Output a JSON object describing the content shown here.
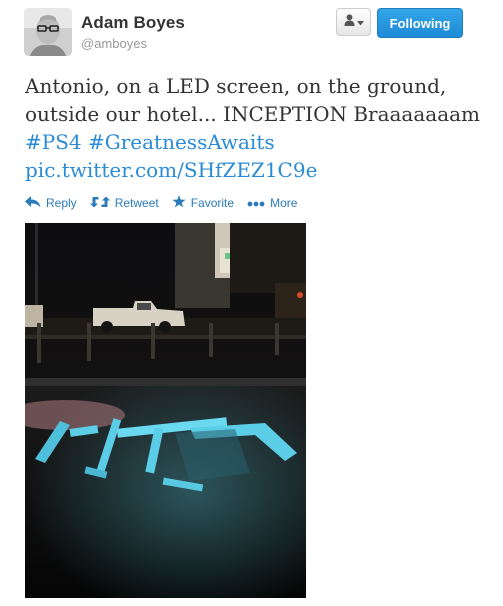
{
  "user": {
    "name": "Adam Boyes",
    "handle": "@amboyes"
  },
  "buttons": {
    "user_dropdown_icon": "person-icon",
    "following_label": "Following"
  },
  "tweet": {
    "text_line1": "Antonio, on a LED screen, on the ground,",
    "text_line2": "outside our hotel... INCEPTION Braaaaaaam",
    "hashtag_1": "#PS4",
    "hashtag_2": "#GreatnessAwaits",
    "media_link": "pic.twitter.com/SHfZEZ1C9e"
  },
  "actions": {
    "reply": "Reply",
    "retweet": "Retweet",
    "favorite": "Favorite",
    "more": "More"
  },
  "colors": {
    "link": "#2a8bd6",
    "following_button": "#1d8ad6",
    "handle": "#999999"
  }
}
